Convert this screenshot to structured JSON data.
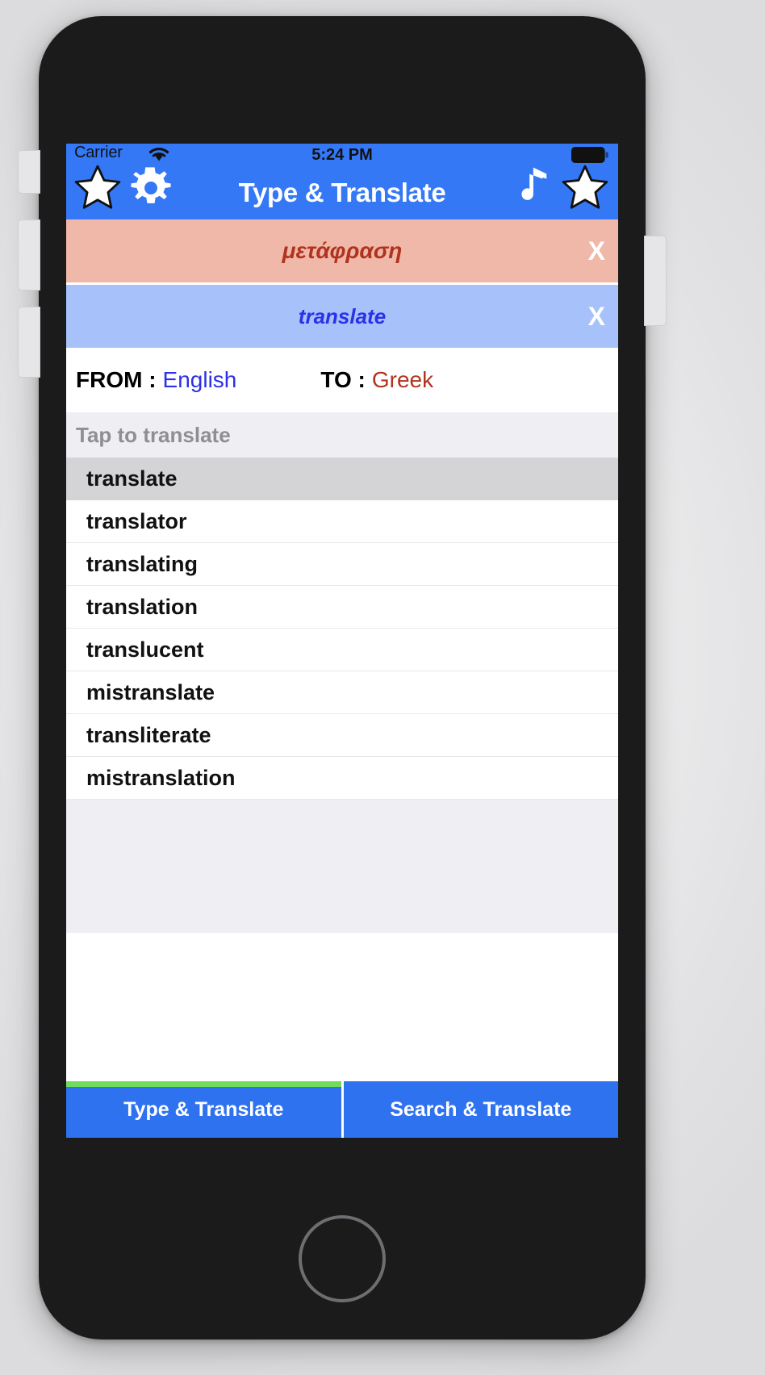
{
  "status_bar": {
    "carrier": "Carrier",
    "wifi_icon": "wifi-icon",
    "clock": "5:24 PM",
    "battery_icon": "battery-full-icon"
  },
  "nav_bar": {
    "title": "Type & Translate",
    "left_icons": [
      {
        "name": "favorites-star-icon",
        "glyph": "★"
      },
      {
        "name": "settings-gear-icon",
        "glyph": "⚙"
      }
    ],
    "right_icons": [
      {
        "name": "music-note-icon",
        "glyph": "♪"
      },
      {
        "name": "favorite-star-icon",
        "glyph": "★"
      }
    ]
  },
  "translation": {
    "target_text": "μετάφραση",
    "target_bar_color": "#f0b8a8",
    "target_text_color": "#b0331f",
    "source_text": "translate",
    "source_bar_color": "#a7c2fb",
    "source_text_color": "#2b31e8",
    "close_label": "X"
  },
  "languages": {
    "from_label": "FROM :",
    "from_value": "English",
    "to_label": "TO :",
    "to_value": "Greek"
  },
  "hint": {
    "text": "Tap to translate"
  },
  "word_list": {
    "items": [
      {
        "word": "translate",
        "selected": true
      },
      {
        "word": "translator",
        "selected": false
      },
      {
        "word": "translating",
        "selected": false
      },
      {
        "word": "translation",
        "selected": false
      },
      {
        "word": "translucent",
        "selected": false
      },
      {
        "word": "mistranslate",
        "selected": false
      },
      {
        "word": "transliterate",
        "selected": false
      },
      {
        "word": "mistranslation",
        "selected": false
      }
    ]
  },
  "tab_bar": {
    "tabs": [
      {
        "label": "Type & Translate",
        "active": true
      },
      {
        "label": "Search & Translate",
        "active": false
      }
    ],
    "active_indicator_color": "#6fdd5a",
    "tab_color": "#2f72f0"
  }
}
